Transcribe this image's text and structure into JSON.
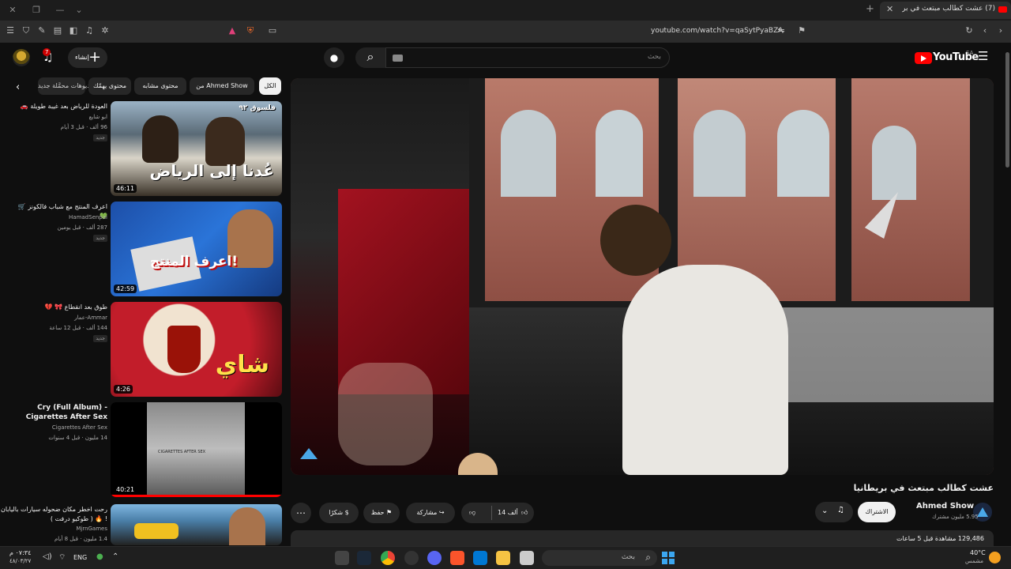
{
  "browser": {
    "tab_title": "(7) عشت كطالب مبتعث في بر",
    "url": "youtube.com/watch?v=qaSytPyaBZA"
  },
  "header": {
    "logo_text": "YouTube",
    "region": "SA",
    "search_placeholder": "بحث",
    "create_label": "إنشاء",
    "notifications_count": "7"
  },
  "chips": [
    {
      "label": "الكل",
      "active": true
    },
    {
      "label": "من Ahmed Show",
      "active": false
    },
    {
      "label": "محتوى مشابه",
      "active": false
    },
    {
      "label": "محتوى يهمّك",
      "active": false
    },
    {
      "label": "فيديوهات محمَّلة جديد",
      "active": false
    }
  ],
  "recommendations": [
    {
      "title": "العودة للرياض بعد غيبة طويلة 🚗",
      "channel": "ابو شايع",
      "meta": "96 ألف · قبل 3 أيام",
      "badge": "جديد",
      "duration": "46:11"
    },
    {
      "title": "اعرف المنتج مع شباب فالكونز 🛒 💚",
      "channel": "HamadSenpai",
      "meta": "287 ألف · قبل يومين",
      "badge": "جديد",
      "duration": "42:59"
    },
    {
      "title": "طوق بعد انقطاع 🎀 💔",
      "channel": "Ammar-عمار",
      "meta": "144 ألف · قبل 12 ساعة",
      "badge": "جديد",
      "duration": "4:26"
    },
    {
      "title": "Cry (Full Album) - Cigarettes After Sex",
      "channel": "Cigarettes After Sex",
      "meta": "14 مليون · قبل 4 سنوات",
      "badge": "",
      "duration": "40:21"
    },
    {
      "title": "رحت اخطر مكان ضحوله سيارات باليابان ! 🔥 ( طوكيو درفت )",
      "channel": "MjrnGames",
      "meta": "1.4 مليون · قبل 8 أيام",
      "badge": "",
      "duration": ""
    }
  ],
  "thumb_texts": {
    "rec1_main": "عُدنا إلى الرياض",
    "rec1_corner": "فلسوق ٩٢",
    "rec2_main": "اعرف المنتج!",
    "rec3_main": "شاي",
    "rec4_main": "CIGARETTES AFTER SEX"
  },
  "video": {
    "title": "عشت كطالب مبتعث في بريطانيا",
    "channel": "Ahmed Show",
    "subscribers": "5.95 مليون مشترك",
    "subscribe_label": "الاشتراك",
    "likes": "14 ألف",
    "share_label": "مشاركة",
    "save_label": "حفظ",
    "thanks_label": "شكرًا",
    "views": "129,486 مشاهدة قبل 5 ساعات"
  },
  "taskbar": {
    "search_placeholder": "بحث",
    "temperature": "40°C",
    "weather": "مشمس",
    "time": "٠٧:٣٤ م",
    "date": "٤٨/٠٣/٢٧",
    "language": "ENG"
  },
  "colors": {
    "brand_red": "#ff0000",
    "background": "#0f0f0f",
    "chip": "#272727"
  }
}
